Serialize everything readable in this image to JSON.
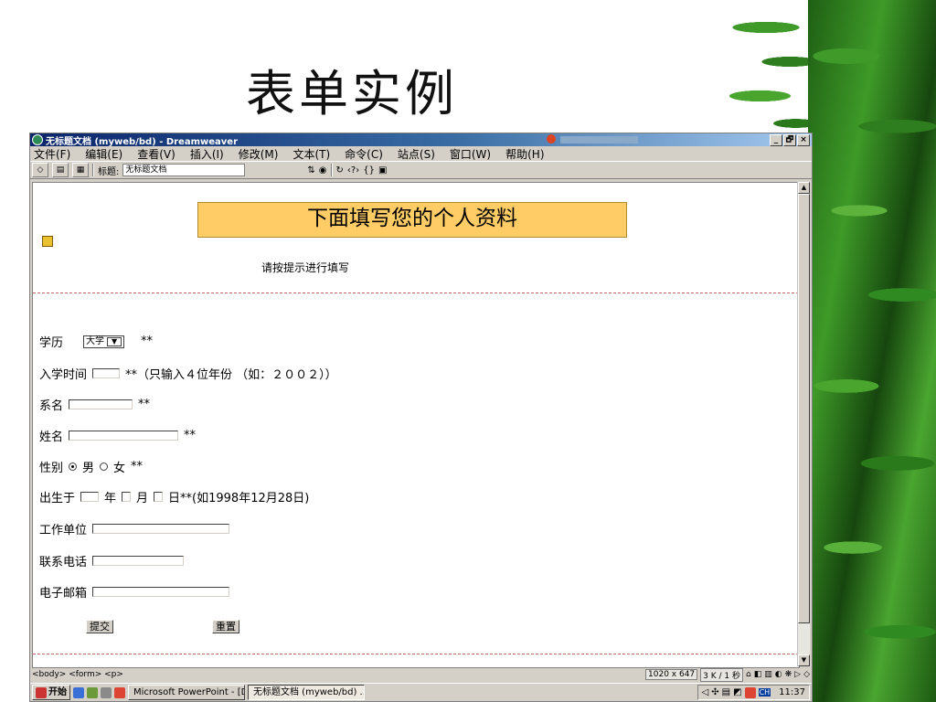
{
  "slide": {
    "title": "表单实例"
  },
  "window": {
    "title": "无标题文档 (myweb/bd) - Dreamweaver",
    "controls": [
      "_",
      "🗗",
      "×"
    ],
    "menu": [
      "文件(F)",
      "编辑(E)",
      "查看(V)",
      "插入(I)",
      "修改(M)",
      "文本(T)",
      "命令(C)",
      "站点(S)",
      "窗口(W)",
      "帮助(H)"
    ],
    "toolbar": {
      "title_label": "标题:",
      "title_value": "无标题文档"
    }
  },
  "document": {
    "banner": "下面填写您的个人资料",
    "hint": "请按提示进行填写",
    "form": {
      "education": {
        "label": "学历",
        "selected": "大学",
        "mark": "**"
      },
      "enroll": {
        "label": "入学时间",
        "note": "**（只输入４位年份 （如：２００２））"
      },
      "department": {
        "label": "系名",
        "mark": "**"
      },
      "name": {
        "label": "姓名",
        "mark": "**"
      },
      "gender": {
        "label": "性别",
        "male": "男",
        "female": "女",
        "mark": "**",
        "selected": "男"
      },
      "birth": {
        "label": "出生于",
        "year": "年",
        "month": "月",
        "day_note": "日**(如1998年12月28日)"
      },
      "work": {
        "label": "工作单位"
      },
      "phone": {
        "label": "联系电话"
      },
      "email": {
        "label": "电子邮箱"
      },
      "submit": "提交",
      "reset": "重置"
    }
  },
  "status": {
    "tags": "<body> <form> <p>",
    "size": "1020 x 647",
    "speed": "3 K / 1 秒"
  },
  "taskbar": {
    "start": "开始",
    "tasks": [
      "Microsoft PowerPoint - [D...",
      "无标题文档 (myweb/bd) ..."
    ],
    "time": "11:37",
    "ime": "CH"
  },
  "colors": {
    "banner_bg": "#ffcc66",
    "title_bar": "#0a246a",
    "bamboo": "#2e7d1e"
  }
}
